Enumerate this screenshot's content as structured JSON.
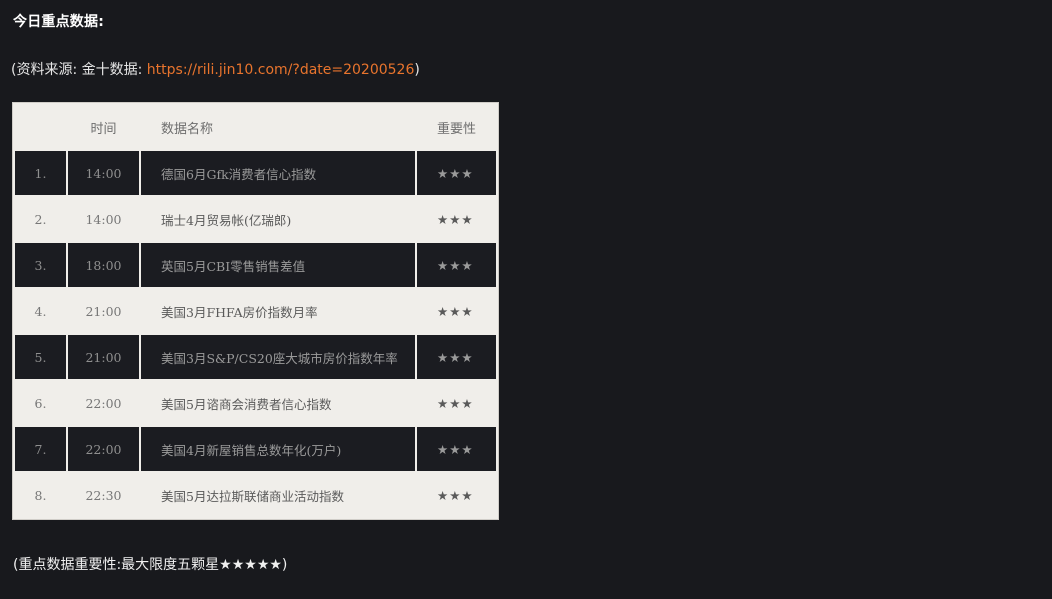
{
  "title": "今日重点数据:",
  "source": {
    "prefix": "(资料来源: 金十数据: ",
    "link": "https://rili.jin10.com/?date=20200526",
    "suffix": ")"
  },
  "table": {
    "headers": [
      "",
      "时间",
      "数据名称",
      "重要性"
    ],
    "rows": [
      {
        "idx": "1.",
        "time": "14:00",
        "name": "德国6月Gfk消费者信心指数",
        "importance": "★★★"
      },
      {
        "idx": "2.",
        "time": "14:00",
        "name": "瑞士4月贸易帐(亿瑞郎)",
        "importance": "★★★"
      },
      {
        "idx": "3.",
        "time": "18:00",
        "name": "英国5月CBI零售销售差值",
        "importance": "★★★"
      },
      {
        "idx": "4.",
        "time": "21:00",
        "name": "美国3月FHFA房价指数月率",
        "importance": "★★★"
      },
      {
        "idx": "5.",
        "time": "21:00",
        "name": "美国3月S&P/CS20座大城市房价指数年率",
        "importance": "★★★"
      },
      {
        "idx": "6.",
        "time": "22:00",
        "name": "美国5月谘商会消费者信心指数",
        "importance": "★★★"
      },
      {
        "idx": "7.",
        "time": "22:00",
        "name": "美国4月新屋销售总数年化(万户)",
        "importance": "★★★"
      },
      {
        "idx": "8.",
        "time": "22:30",
        "name": "美国5月达拉斯联储商业活动指数",
        "importance": "★★★"
      }
    ]
  },
  "note": "(重点数据重要性:最大限度五颗星★★★★★)",
  "colors": {
    "background": "#18191d",
    "link": "#e8742d",
    "light_row": "#f0eeea",
    "dark_row": "#1b1c21"
  }
}
